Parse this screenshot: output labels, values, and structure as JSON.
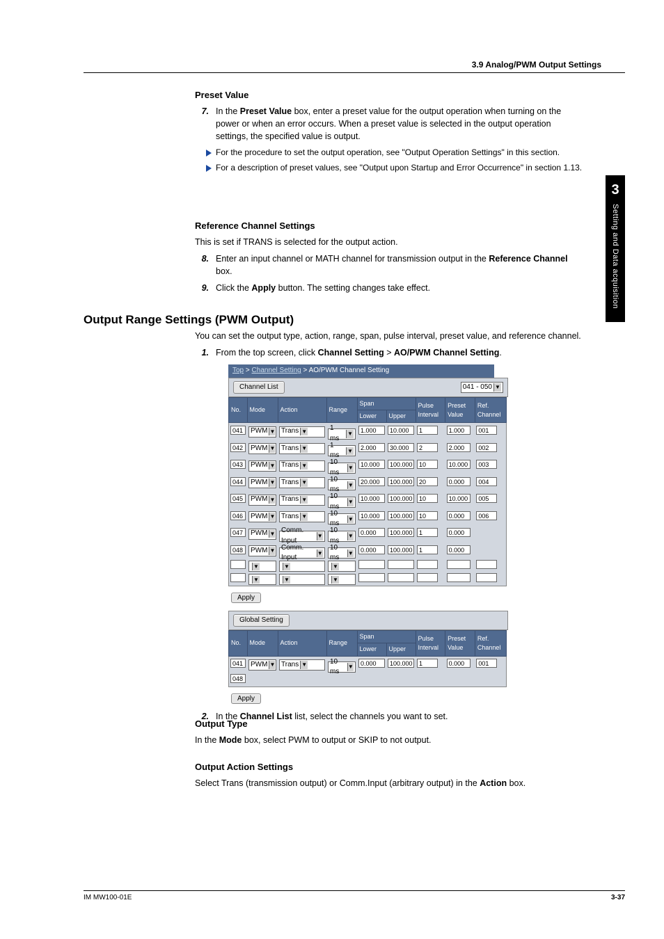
{
  "header": {
    "section": "3.9  Analog/PWM Output Settings"
  },
  "sidetab": {
    "chapter": "3",
    "label": "Setting and Data acquisition"
  },
  "preset": {
    "heading": "Preset Value",
    "step7_num": "7.",
    "step7_a": "In the ",
    "step7_b": "Preset Value",
    "step7_c": " box, enter a preset value for the output operation when turning on the power or when an error occurs. When a preset value is selected in the output operation settings, the specified value is output.",
    "note1": "For the procedure to set the output operation, see \"Output Operation Settings\" in  this section.",
    "note2": "For a description of preset values, see \"Output upon Startup and Error Occurrence\" in section 1.13."
  },
  "refch": {
    "heading": "Reference Channel Settings",
    "intro": "This is set if TRANS is selected for the output action.",
    "step8_num": "8.",
    "step8_a": "Enter an input channel or MATH channel for transmission output in the ",
    "step8_b": "Reference Channel",
    "step8_c": " box.",
    "step9_num": "9.",
    "step9_a": "Click the ",
    "step9_b": "Apply",
    "step9_c": " button. The setting changes take effect."
  },
  "outrange": {
    "h2": "Output Range Settings (PWM Output)",
    "intro": "You can set the output type, action, range, span, pulse interval, preset value, and reference channel.",
    "step1_num": "1.",
    "step1_a": "From the top screen, click ",
    "step1_b": "Channel Setting",
    "step1_c": " > ",
    "step1_d": "AO/PWM Channel Setting",
    "step1_e": ".",
    "step2_num": "2.",
    "step2_a": "In the ",
    "step2_b": "Channel List",
    "step2_c": " list, select the channels you want to set."
  },
  "outtype": {
    "heading": "Output Type",
    "body_a": "In the ",
    "body_b": "Mode",
    "body_c": " box, select PWM to output or SKIP to not output."
  },
  "outaction": {
    "heading": "Output Action Settings",
    "body_a": "Select Trans (transmission output) or Comm.Input (arbitrary output) in the ",
    "body_b": "Action",
    "body_c": " box."
  },
  "fig": {
    "crumb_top": "Top",
    "crumb_cs": "Channel Setting",
    "crumb_page": "AO/PWM Channel Setting",
    "btn_channel_list": "Channel List",
    "sel_range": "041 - 050",
    "btn_apply": "Apply",
    "btn_global": "Global Setting",
    "hdr": {
      "no": "No.",
      "mode": "Mode",
      "action": "Action",
      "range": "Range",
      "span": "Span",
      "lower": "Lower",
      "upper": "Upper",
      "pulse": "Pulse Interval",
      "preset": "Preset Value",
      "ref": "Ref. Channel"
    },
    "rows": [
      {
        "no": "041",
        "mode": "PWM",
        "action": "Trans",
        "range": "1 ms",
        "lower": "1.000",
        "upper": "10.000",
        "pulse": "1",
        "preset": "1.000",
        "ref": "001"
      },
      {
        "no": "042",
        "mode": "PWM",
        "action": "Trans",
        "range": "1 ms",
        "lower": "2.000",
        "upper": "30.000",
        "pulse": "2",
        "preset": "2.000",
        "ref": "002"
      },
      {
        "no": "043",
        "mode": "PWM",
        "action": "Trans",
        "range": "10 ms",
        "lower": "10.000",
        "upper": "100.000",
        "pulse": "10",
        "preset": "10.000",
        "ref": "003"
      },
      {
        "no": "044",
        "mode": "PWM",
        "action": "Trans",
        "range": "10 ms",
        "lower": "20.000",
        "upper": "100.000",
        "pulse": "20",
        "preset": "0.000",
        "ref": "004"
      },
      {
        "no": "045",
        "mode": "PWM",
        "action": "Trans",
        "range": "10 ms",
        "lower": "10.000",
        "upper": "100.000",
        "pulse": "10",
        "preset": "10.000",
        "ref": "005"
      },
      {
        "no": "046",
        "mode": "PWM",
        "action": "Trans",
        "range": "10 ms",
        "lower": "10.000",
        "upper": "100.000",
        "pulse": "10",
        "preset": "0.000",
        "ref": "006"
      },
      {
        "no": "047",
        "mode": "PWM",
        "action": "Comm. Input",
        "range": "10 ms",
        "lower": "0.000",
        "upper": "100.000",
        "pulse": "1",
        "preset": "0.000",
        "ref": ""
      },
      {
        "no": "048",
        "mode": "PWM",
        "action": "Comm. Input",
        "range": "10 ms",
        "lower": "0.000",
        "upper": "100.000",
        "pulse": "1",
        "preset": "0.000",
        "ref": ""
      }
    ],
    "global_rows": [
      {
        "no": "041",
        "mode": "PWM",
        "action": "Trans",
        "range": "10 ms",
        "lower": "0.000",
        "upper": "100.000",
        "pulse": "1",
        "preset": "0.000",
        "ref": "001"
      },
      {
        "no": "048",
        "mode": "",
        "action": "",
        "range": "",
        "lower": "",
        "upper": "",
        "pulse": "",
        "preset": "",
        "ref": ""
      }
    ]
  },
  "footer": {
    "left": "IM MW100-01E",
    "right": "3-37"
  }
}
